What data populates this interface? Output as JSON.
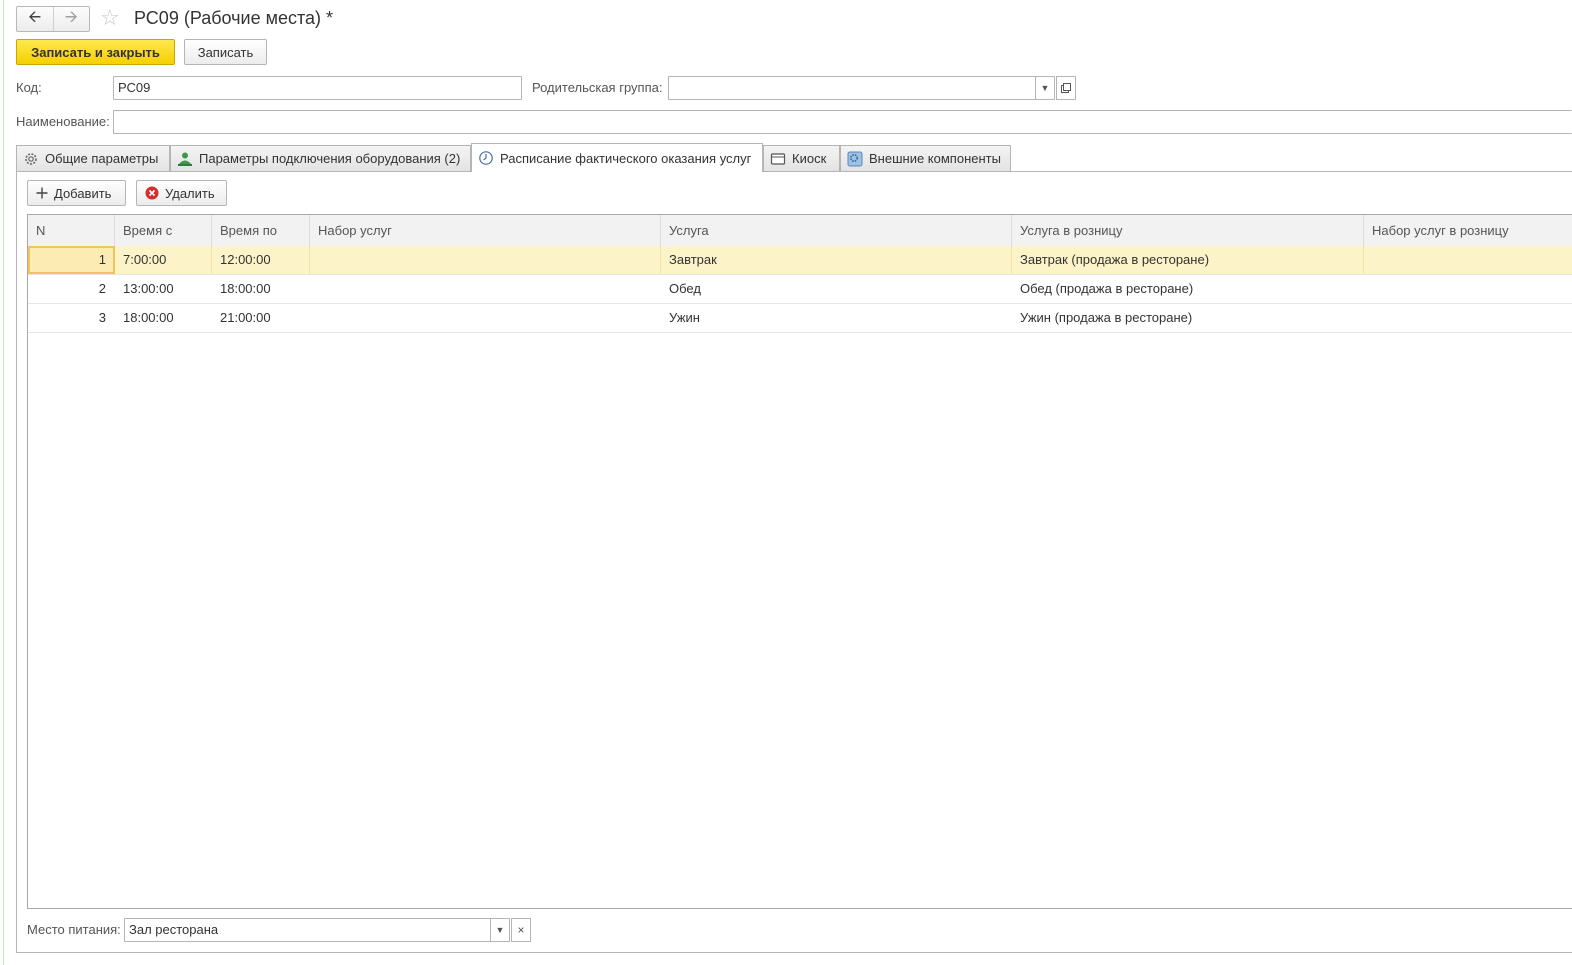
{
  "window": {
    "title": "РС09 (Рабочие места) *",
    "back_icon": "arrow-left-icon",
    "forward_icon": "arrow-right-icon",
    "favorite_icon": "star-icon"
  },
  "commands": {
    "save_close_label": "Записать и закрыть",
    "save_label": "Записать"
  },
  "form": {
    "code_label": "Код:",
    "code_value": "РС09",
    "parent_group_label": "Родительская группа:",
    "parent_group_value": "",
    "name_label": "Наименование:",
    "name_value": ""
  },
  "tabs": [
    {
      "label": "Общие параметры",
      "icon": "gear-icon",
      "active": false
    },
    {
      "label": "Параметры подключения оборудования (2)",
      "icon": "equipment-user-icon",
      "active": false
    },
    {
      "label": "Расписание фактического оказания услуг",
      "icon": "clock-icon",
      "active": true
    },
    {
      "label": "Киоск",
      "icon": "kiosk-icon",
      "active": false
    },
    {
      "label": "Внешние компоненты",
      "icon": "components-icon",
      "active": false
    }
  ],
  "toolbar": {
    "add_label": "Добавить",
    "delete_label": "Удалить"
  },
  "table": {
    "columns": [
      "N",
      "Время с",
      "Время по",
      "Набор услуг",
      "Услуга",
      "Услуга в розницу",
      "Набор услуг в розницу"
    ],
    "rows": [
      {
        "n": "1",
        "from": "7:00:00",
        "to": "12:00:00",
        "set": "",
        "service": "Завтрак",
        "retail": "Завтрак (продажа в ресторане)",
        "retail_set": ""
      },
      {
        "n": "2",
        "from": "13:00:00",
        "to": "18:00:00",
        "set": "",
        "service": "Обед",
        "retail": "Обед (продажа в ресторане)",
        "retail_set": ""
      },
      {
        "n": "3",
        "from": "18:00:00",
        "to": "21:00:00",
        "set": "",
        "service": "Ужин",
        "retail": "Ужин (продажа в ресторане)",
        "retail_set": ""
      }
    ],
    "selected_row": 1
  },
  "footer": {
    "place_label": "Место питания:",
    "place_value": "Зал ресторана"
  },
  "colors": {
    "primary_button": "#f5d000",
    "selected_row": "#fdf3c8"
  }
}
